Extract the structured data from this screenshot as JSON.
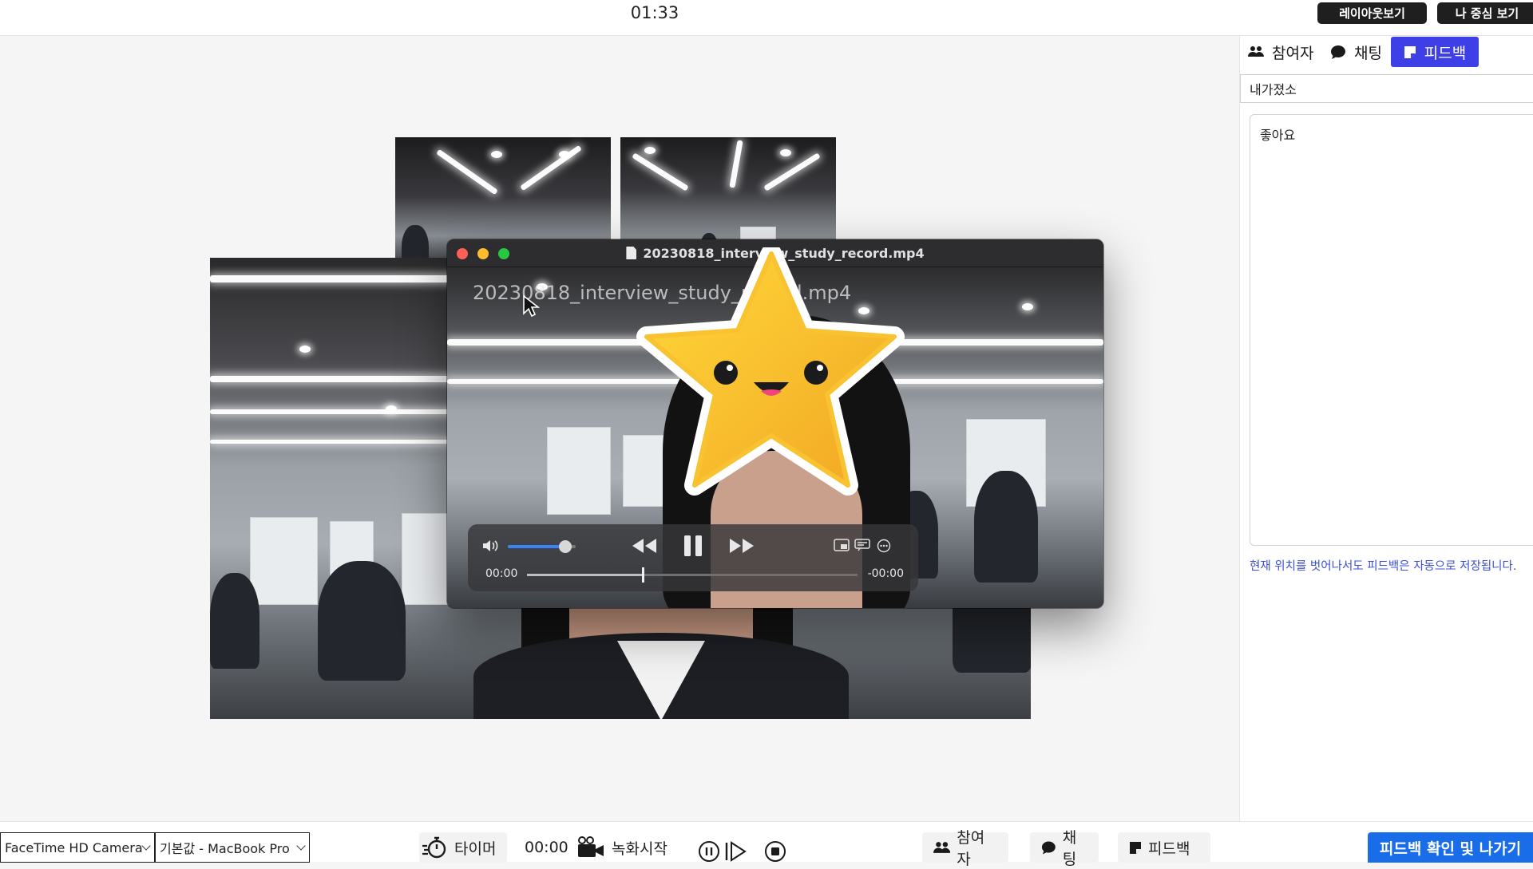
{
  "header": {
    "clock": "01:33",
    "layout_button": "레이아웃보기",
    "me_focus_button": "나 중심 보기"
  },
  "player": {
    "window_title": "20230818_interview_study_record.mp4",
    "overlay_filename": "20230818_interview_study_record.mp4",
    "time_elapsed": "00:00",
    "time_remaining": "-00:00",
    "volume": 0.85,
    "progress": 0.35
  },
  "sidebar": {
    "tabs": [
      {
        "label": "참여자",
        "icon": "people-icon"
      },
      {
        "label": "채팅",
        "icon": "chat-bubble-icon"
      },
      {
        "label": "피드백",
        "icon": "note-icon",
        "active": true
      }
    ],
    "title_value": "내가졌소",
    "body_value": "좋아요",
    "autosave_note": "현재 위치를 벗어나서도 피드백은 자동으로 저장됩니다."
  },
  "bottombar": {
    "camera_select": "FaceTime HD Camera",
    "mic_select": "기본값 - MacBook Pro",
    "timer_label": "타이머",
    "record_time": "00:00",
    "record_label": "녹화시작",
    "participants_label": "참여자",
    "chat_label": "채팅",
    "feedback_label": "피드백",
    "exit_label": "피드백 확인 및 나가기"
  },
  "colors": {
    "accent": "#3f3fe8",
    "exit_button": "#1a6de8",
    "note_text": "#3b4fd8",
    "star": "#f5c02c"
  }
}
